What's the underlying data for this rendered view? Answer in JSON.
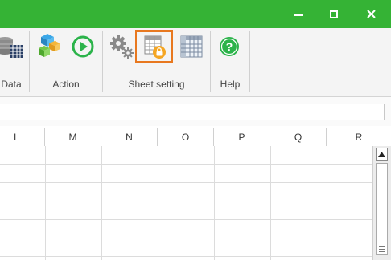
{
  "window": {
    "accent_color": "#35b335",
    "buttons": [
      {
        "name": "minimize",
        "icon": "minimize-icon"
      },
      {
        "name": "maximize",
        "icon": "maximize-icon"
      },
      {
        "name": "close",
        "icon": "close-icon"
      }
    ]
  },
  "ribbon": {
    "groups": [
      {
        "label": "Data",
        "buttons": [
          "database-grid-icon"
        ]
      },
      {
        "label": "Action",
        "buttons": [
          "blocks-icon",
          "play-icon"
        ]
      },
      {
        "label": "Sheet setting",
        "buttons": [
          "gears-icon",
          "protect-sheet-icon",
          "grid-table-icon"
        ]
      },
      {
        "label": "Help",
        "buttons": [
          "help-icon"
        ]
      }
    ],
    "selected_button": "protect-sheet-icon",
    "selection_color": "#e8781f"
  },
  "formula_bar": {
    "value": ""
  },
  "grid": {
    "columns": [
      "L",
      "M",
      "N",
      "O",
      "P",
      "Q",
      "R"
    ]
  }
}
